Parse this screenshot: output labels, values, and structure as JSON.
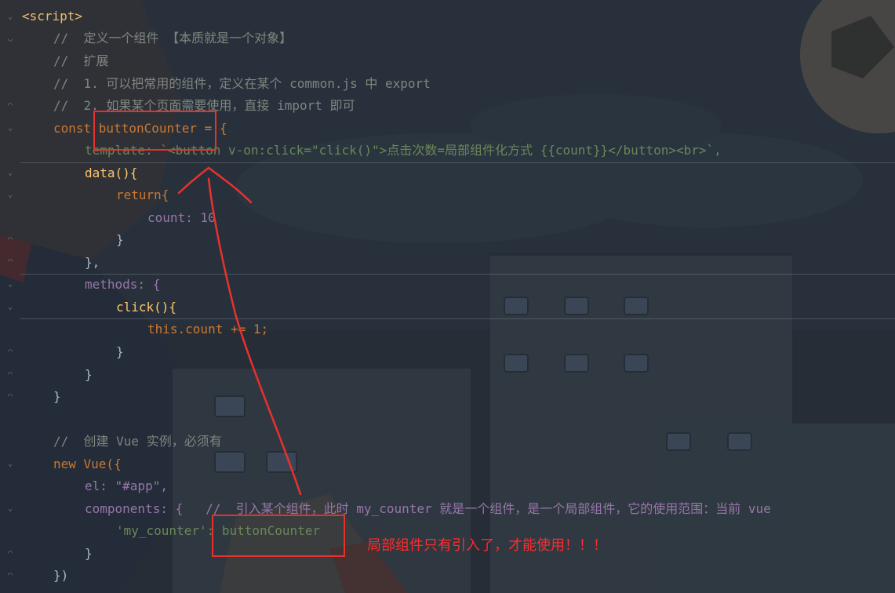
{
  "lines": [
    {
      "text": "<script>",
      "type": "tag"
    },
    {
      "text": "//  定义一个组件 【本质就是一个对象】",
      "type": "comment"
    },
    {
      "text": "//  扩展",
      "type": "comment"
    },
    {
      "text": "//  1. 可以把常用的组件，定义在某个 common.js 中 export",
      "type": "comment"
    },
    {
      "text": "//  2. 如果某个页面需要使用，直接 import 即可",
      "type": "comment"
    },
    {
      "text": "const buttonCounter = {",
      "type": "decl"
    },
    {
      "text": "template: `<button v-on:click=\"click()\">点击次数=局部组件化方式 {{count}}</button><br>`,",
      "type": "template"
    },
    {
      "text": "data(){",
      "type": "method"
    },
    {
      "text": "return{",
      "type": "return"
    },
    {
      "text": "count: 10",
      "type": "propnum"
    },
    {
      "text": "}",
      "type": "plain"
    },
    {
      "text": "},",
      "type": "plain"
    },
    {
      "text": "methods: {",
      "type": "propopen"
    },
    {
      "text": "click(){",
      "type": "method"
    },
    {
      "text": "this.count += 1;",
      "type": "stmt"
    },
    {
      "text": "}",
      "type": "plain"
    },
    {
      "text": "}",
      "type": "plain"
    },
    {
      "text": "}",
      "type": "plain"
    },
    {
      "text": "",
      "type": "plain"
    },
    {
      "text": "//  创建 Vue 实例，必须有",
      "type": "comment"
    },
    {
      "text": "new Vue({",
      "type": "newvue"
    },
    {
      "text": "el: \"#app\",",
      "type": "propstr"
    },
    {
      "text": "components: {   //  引入某个组件，此时 my_counter 就是一个组件，是一个局部组件，它的使用范围：当前 vue",
      "type": "components"
    },
    {
      "text": "'my_counter': buttonCounter",
      "type": "registration"
    },
    {
      "text": "}",
      "type": "plain"
    },
    {
      "text": "})",
      "type": "plain"
    }
  ],
  "annotation": {
    "note": "局部组件只有引入了，才能使用！！！",
    "highlight_words": [
      "buttonCounter",
      "buttonCounter"
    ]
  },
  "colors": {
    "annotation_red": "#e8312e",
    "keyword": "#cc7832",
    "comment": "#7f8680",
    "property": "#9876aa",
    "function": "#ffc66d",
    "string": "#6a8759",
    "number": "#6897bb"
  }
}
